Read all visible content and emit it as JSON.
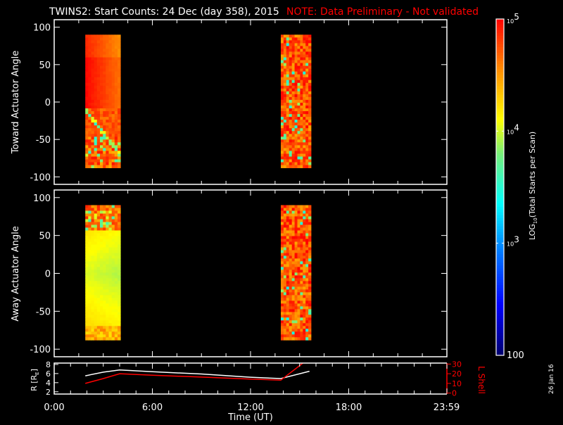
{
  "chart_data": [
    {
      "type": "heatmap",
      "title": "TWINS2: Start Counts: 24 Dec (day 358), 2015",
      "note": "NOTE: Data Preliminary - Not validated",
      "ylabel": "Toward Actuator Angle",
      "ylim": [
        -110,
        110
      ],
      "yticks": [
        100,
        50,
        0,
        -50,
        -100
      ],
      "xlim": [
        0,
        24
      ],
      "blocks": [
        {
          "t_start": 1.9,
          "t_end": 4.05,
          "angle_min": -88,
          "angle_max": 90,
          "pattern": "toward-early"
        },
        {
          "t_start": 13.85,
          "t_end": 15.7,
          "angle_min": -88,
          "angle_max": 90,
          "pattern": "noisy"
        }
      ]
    },
    {
      "type": "heatmap",
      "ylabel": "Away Actuator Angle",
      "ylim": [
        -110,
        110
      ],
      "yticks": [
        100,
        50,
        0,
        -50,
        -100
      ],
      "xlim": [
        0,
        24
      ],
      "blocks": [
        {
          "t_start": 1.9,
          "t_end": 4.05,
          "angle_min": -88,
          "angle_max": 90,
          "pattern": "away-early"
        },
        {
          "t_start": 13.85,
          "t_end": 15.7,
          "angle_min": -88,
          "angle_max": 90,
          "pattern": "noisy"
        }
      ]
    },
    {
      "type": "line",
      "xlabel": "Time (UT)",
      "ylabel": "R [R",
      "ylabel_sub": "E",
      "ylabel_close": "]",
      "ylim": [
        1.5,
        8.3
      ],
      "yticks": [
        8,
        6,
        4,
        2
      ],
      "y2label": "L Shell",
      "y2lim": [
        -1,
        31
      ],
      "y2ticks": [
        30,
        20,
        10,
        0
      ],
      "xlim": [
        0,
        24
      ],
      "xticks": [
        0,
        6,
        12,
        18,
        23.98
      ],
      "xtick_labels": [
        "0:00",
        "6:00",
        "12:00",
        "18:00",
        "23:59"
      ],
      "series": [
        {
          "name": "R",
          "axis": "left",
          "color": "#ffffff",
          "x": [
            1.9,
            3.0,
            4.0,
            6.0,
            9.0,
            12.0,
            13.85,
            15.6
          ],
          "y": [
            5.5,
            6.3,
            6.8,
            6.4,
            5.9,
            5.2,
            4.9,
            6.5
          ]
        },
        {
          "name": "L Shell",
          "axis": "right",
          "color": "#ff0000",
          "x": [
            1.9,
            3.0,
            4.0,
            6.0,
            9.0,
            12.0,
            13.85,
            15.2
          ],
          "y": [
            10,
            15,
            20,
            18.5,
            16.5,
            14.5,
            13.3,
            31
          ]
        }
      ]
    }
  ],
  "colorbar": {
    "label_prefix": "LOG",
    "label_sub": "10",
    "label_rest": "(Total Starts per Scan)",
    "ticks": [
      {
        "value": 100000,
        "base": "10",
        "exp": "5"
      },
      {
        "value": 10000,
        "base": "10",
        "exp": "4"
      },
      {
        "value": 1000,
        "base": "10",
        "exp": "3"
      },
      {
        "value": 100,
        "base": "100",
        "exp": ""
      }
    ],
    "range": [
      100,
      100000
    ]
  },
  "footer_date": "26 Jan 16",
  "colors": {
    "title": "#ffffff",
    "note": "#ff0000",
    "lshell": "#ff0000"
  }
}
